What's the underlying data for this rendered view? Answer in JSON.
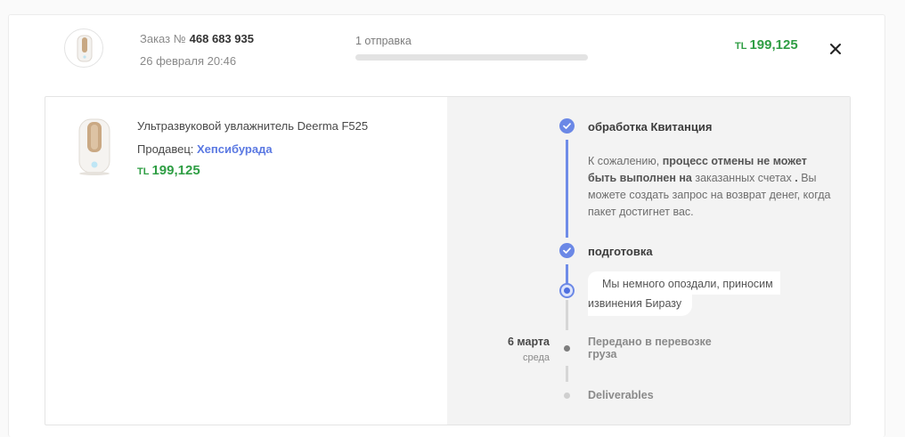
{
  "order": {
    "label": "Заказ №",
    "number": "468 683 935",
    "date": "26 февраля 20:46",
    "shipments_label": "1 отправка",
    "currency": "TL",
    "total": "199,125"
  },
  "product": {
    "name": "Ультразвуковой увлажнитель Deerma F525",
    "seller_label": "Продавец:",
    "seller_name": "Хепсибурада",
    "currency": "TL",
    "price": "199,125"
  },
  "timeline": {
    "step1_title": "обработка Квитанция",
    "step1_text_a": "К сожалению,",
    "step1_text_b": "процесс отмены не может быть выполнен на",
    "step1_text_c": "заказанных счетах",
    "step1_text_d": ".",
    "step1_text_e": "Вы можете создать запрос на возврат денег, когда пакет достигнет вас.",
    "step2_title": "подготовка",
    "bubble_line1": "Мы немного опоздали, приносим",
    "bubble_line2": "извинения Биразу",
    "step3_date": "6 марта",
    "step3_day": "среда",
    "step3_title": "Передано в перевозке груза",
    "step4_title": "Deliverables"
  },
  "colors": {
    "price_green": "#2f9e44",
    "accent_blue": "#6b88e6",
    "seller_link": "#5a78e2"
  }
}
